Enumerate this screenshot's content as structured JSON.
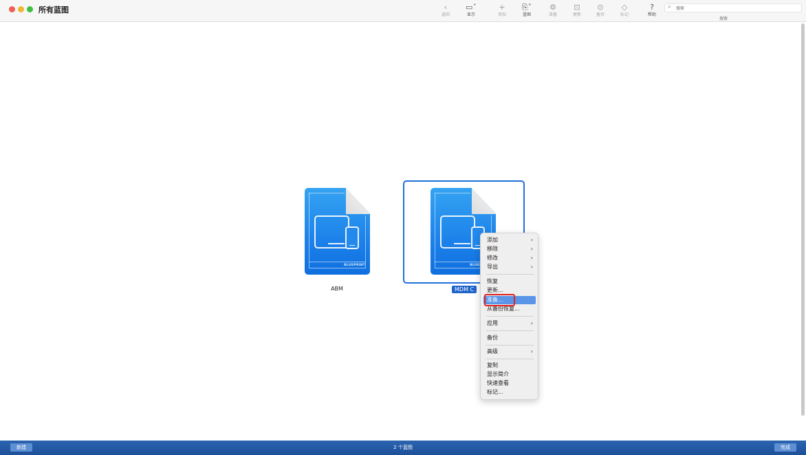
{
  "window": {
    "title": "所有蓝图"
  },
  "toolbar": {
    "back": {
      "icon": "chevron-left-icon",
      "glyph": "‹",
      "label": "返回"
    },
    "view": {
      "icon": "window-view-icon",
      "glyph": "▭ˇ",
      "label": "显示"
    },
    "add": {
      "icon": "plus-icon",
      "glyph": "+",
      "label": "添加"
    },
    "blueprint": {
      "icon": "blueprint-icon",
      "glyph": "⎘ˇ",
      "label": "蓝图"
    },
    "prepare": {
      "icon": "gear-icon",
      "glyph": "⚙",
      "label": "准备"
    },
    "update": {
      "icon": "update-icon",
      "glyph": "⊡",
      "label": "更新"
    },
    "backup": {
      "icon": "backup-icon",
      "glyph": "⊙",
      "label": "备份"
    },
    "tag": {
      "icon": "tag-icon",
      "glyph": "◇",
      "label": "标记"
    },
    "help": {
      "icon": "help-icon",
      "glyph": "?",
      "label": "帮助"
    },
    "search": {
      "placeholder": "搜索",
      "label": "搜索"
    }
  },
  "blueprints": [
    {
      "name": "ABM",
      "tag": "BLUEPRINT",
      "selected": false
    },
    {
      "name": "MDM C",
      "tag": "BLUEPRINT",
      "selected": true
    }
  ],
  "context_menu": {
    "items": [
      {
        "label": "添加",
        "submenu": true
      },
      {
        "label": "移除",
        "submenu": true
      },
      {
        "label": "修改",
        "submenu": true
      },
      {
        "label": "导出",
        "submenu": true
      },
      {
        "label": "恢复",
        "submenu": false
      },
      {
        "label": "更新...",
        "submenu": false
      },
      {
        "label": "准备...",
        "submenu": false,
        "highlighted": true
      },
      {
        "label": "从备份恢复...",
        "submenu": false
      },
      {
        "label": "应用",
        "submenu": true
      },
      {
        "label": "备份",
        "submenu": false
      },
      {
        "label": "高级",
        "submenu": true
      },
      {
        "label": "复制",
        "submenu": false
      },
      {
        "label": "显示简介",
        "submenu": false
      },
      {
        "label": "快速查看",
        "submenu": false
      },
      {
        "label": "标记...",
        "submenu": false
      }
    ],
    "submenu_arrow": "›"
  },
  "bottombar": {
    "new_label": "新建",
    "count_label": "2 个蓝图",
    "done_label": "完成"
  },
  "colors": {
    "accent": "#1f6fd8",
    "bottombar": "#2a64b0",
    "highlight": "#5a95e8",
    "annotation": "#e0221f"
  }
}
